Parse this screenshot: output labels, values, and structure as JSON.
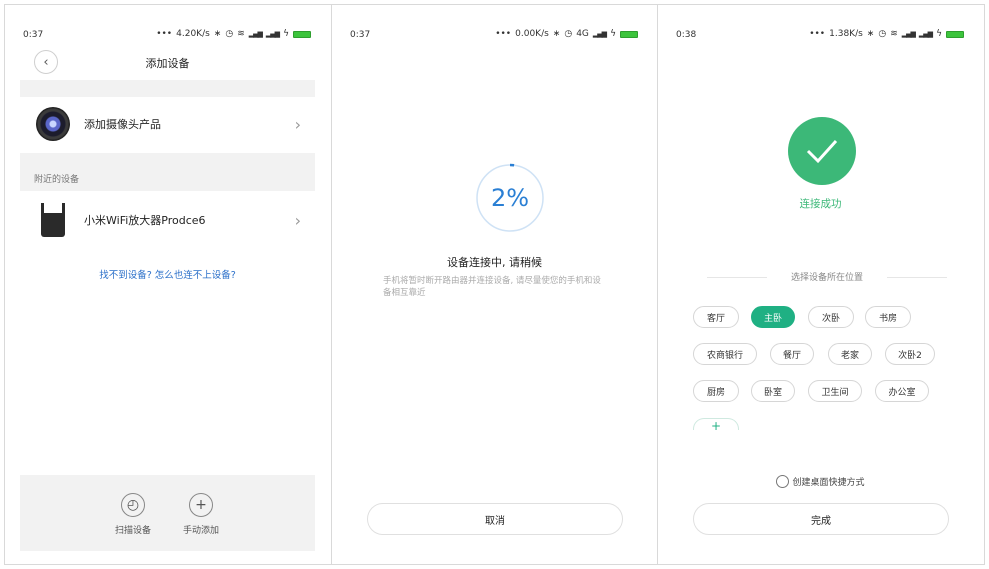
{
  "screens": [
    {
      "status": {
        "time": "0:37",
        "speed": "4.20K/s"
      },
      "header": {
        "title": "添加设备"
      },
      "camera_row": {
        "label": "添加摄像头产品"
      },
      "nearby": {
        "section_label": "附近的设备",
        "device_label": "小米WiFi放大器Prodce6"
      },
      "help_link": "找不到设备? 怎么也连不上设备?",
      "bottom": {
        "scan_label": "扫描设备",
        "manual_label": "手动添加"
      }
    },
    {
      "status": {
        "time": "0:37",
        "speed": "0.00K/s",
        "network": "4G"
      },
      "progress": {
        "text": "2%",
        "value": 2
      },
      "title": "设备连接中, 请稍候",
      "desc": "手机将暂时断开路由器并连接设备, 请尽量使您的手机和设备相互靠近",
      "cancel_label": "取消"
    },
    {
      "status": {
        "time": "0:38",
        "speed": "1.38K/s"
      },
      "success_text": "连接成功",
      "location_label": "选择设备所在位置",
      "rooms": [
        "客厅",
        "主卧",
        "次卧",
        "书房",
        "农商银行",
        "餐厅",
        "老家",
        "次卧2",
        "厨房",
        "卧室",
        "卫生间",
        "办公室"
      ],
      "selected_room": "主卧",
      "shortcut_label": "创建桌面快捷方式",
      "done_label": "完成"
    }
  ],
  "colors": {
    "accent_green": "#1fb083",
    "success_green": "#3cb878",
    "progress_blue": "#2a7fd4",
    "link_blue": "#2a6fc9"
  }
}
